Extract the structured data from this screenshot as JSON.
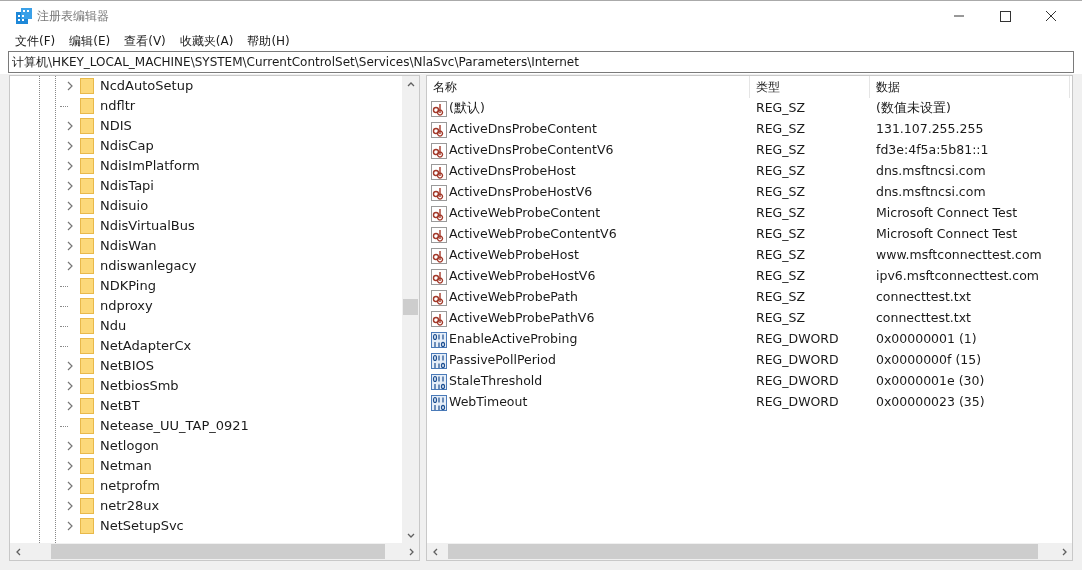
{
  "window": {
    "title": "注册表编辑器"
  },
  "menu": [
    "文件(F)",
    "编辑(E)",
    "查看(V)",
    "收藏夹(A)",
    "帮助(H)"
  ],
  "address": "计算机\\HKEY_LOCAL_MACHINE\\SYSTEM\\CurrentControlSet\\Services\\NlaSvc\\Parameters\\Internet",
  "tree": [
    {
      "label": "NcdAutoSetup",
      "expandable": true
    },
    {
      "label": "ndfltr",
      "expandable": false
    },
    {
      "label": "NDIS",
      "expandable": true
    },
    {
      "label": "NdisCap",
      "expandable": true
    },
    {
      "label": "NdisImPlatform",
      "expandable": true
    },
    {
      "label": "NdisTapi",
      "expandable": true
    },
    {
      "label": "Ndisuio",
      "expandable": true
    },
    {
      "label": "NdisVirtualBus",
      "expandable": true
    },
    {
      "label": "NdisWan",
      "expandable": true
    },
    {
      "label": "ndiswanlegacy",
      "expandable": true
    },
    {
      "label": "NDKPing",
      "expandable": false
    },
    {
      "label": "ndproxy",
      "expandable": false
    },
    {
      "label": "Ndu",
      "expandable": false
    },
    {
      "label": "NetAdapterCx",
      "expandable": false
    },
    {
      "label": "NetBIOS",
      "expandable": true
    },
    {
      "label": "NetbiosSmb",
      "expandable": true
    },
    {
      "label": "NetBT",
      "expandable": true
    },
    {
      "label": "Netease_UU_TAP_0921",
      "expandable": false
    },
    {
      "label": "Netlogon",
      "expandable": true
    },
    {
      "label": "Netman",
      "expandable": true
    },
    {
      "label": "netprofm",
      "expandable": true
    },
    {
      "label": "netr28ux",
      "expandable": true
    },
    {
      "label": "NetSetupSvc",
      "expandable": true
    }
  ],
  "table": {
    "columns": [
      "名称",
      "类型",
      "数据"
    ],
    "rows": [
      {
        "kind": "string",
        "name": "(默认)",
        "type": "REG_SZ",
        "data": "(数值未设置)"
      },
      {
        "kind": "string",
        "name": "ActiveDnsProbeContent",
        "type": "REG_SZ",
        "data": "131.107.255.255"
      },
      {
        "kind": "string",
        "name": "ActiveDnsProbeContentV6",
        "type": "REG_SZ",
        "data": "fd3e:4f5a:5b81::1"
      },
      {
        "kind": "string",
        "name": "ActiveDnsProbeHost",
        "type": "REG_SZ",
        "data": "dns.msftncsi.com"
      },
      {
        "kind": "string",
        "name": "ActiveDnsProbeHostV6",
        "type": "REG_SZ",
        "data": "dns.msftncsi.com"
      },
      {
        "kind": "string",
        "name": "ActiveWebProbeContent",
        "type": "REG_SZ",
        "data": "Microsoft Connect Test"
      },
      {
        "kind": "string",
        "name": "ActiveWebProbeContentV6",
        "type": "REG_SZ",
        "data": "Microsoft Connect Test"
      },
      {
        "kind": "string",
        "name": "ActiveWebProbeHost",
        "type": "REG_SZ",
        "data": "www.msftconnecttest.com"
      },
      {
        "kind": "string",
        "name": "ActiveWebProbeHostV6",
        "type": "REG_SZ",
        "data": "ipv6.msftconnecttest.com"
      },
      {
        "kind": "string",
        "name": "ActiveWebProbePath",
        "type": "REG_SZ",
        "data": "connecttest.txt"
      },
      {
        "kind": "string",
        "name": "ActiveWebProbePathV6",
        "type": "REG_SZ",
        "data": "connecttest.txt"
      },
      {
        "kind": "dword",
        "name": "EnableActiveProbing",
        "type": "REG_DWORD",
        "data": "0x00000001 (1)"
      },
      {
        "kind": "dword",
        "name": "PassivePollPeriod",
        "type": "REG_DWORD",
        "data": "0x0000000f (15)"
      },
      {
        "kind": "dword",
        "name": "StaleThreshold",
        "type": "REG_DWORD",
        "data": "0x0000001e (30)"
      },
      {
        "kind": "dword",
        "name": "WebTimeout",
        "type": "REG_DWORD",
        "data": "0x00000023 (35)"
      }
    ]
  }
}
